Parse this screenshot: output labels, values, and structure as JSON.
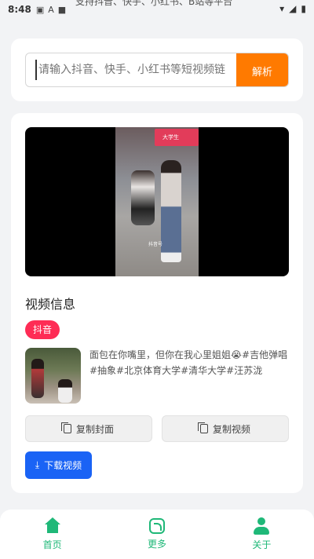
{
  "status_bar": {
    "time": "8:48",
    "notification_text": "支持抖音、快手、小红书、B站等平台"
  },
  "search": {
    "placeholder": "请输入抖音、快手、小红书等短视频链",
    "parse_label": "解析"
  },
  "video": {
    "banner_text": "大学生",
    "watermark": "抖音号"
  },
  "info": {
    "section_title": "视频信息",
    "platform": "抖音",
    "description": "面包在你嘴里，但你在我心里姐姐😭#吉他弹唱#抽象#北京体育大学#清华大学#汪苏泷",
    "copy_cover_label": "复制封面",
    "copy_video_label": "复制视频",
    "download_label": "下载视频"
  },
  "nav": {
    "items": [
      {
        "label": "首页",
        "icon": "home-icon"
      },
      {
        "label": "更多",
        "icon": "more-icon"
      },
      {
        "label": "关于",
        "icon": "about-icon"
      }
    ]
  },
  "colors": {
    "accent_orange": "#ff7a00",
    "douyin_red": "#fe2c55",
    "download_blue": "#1a63f5",
    "nav_green": "#1fb878"
  }
}
